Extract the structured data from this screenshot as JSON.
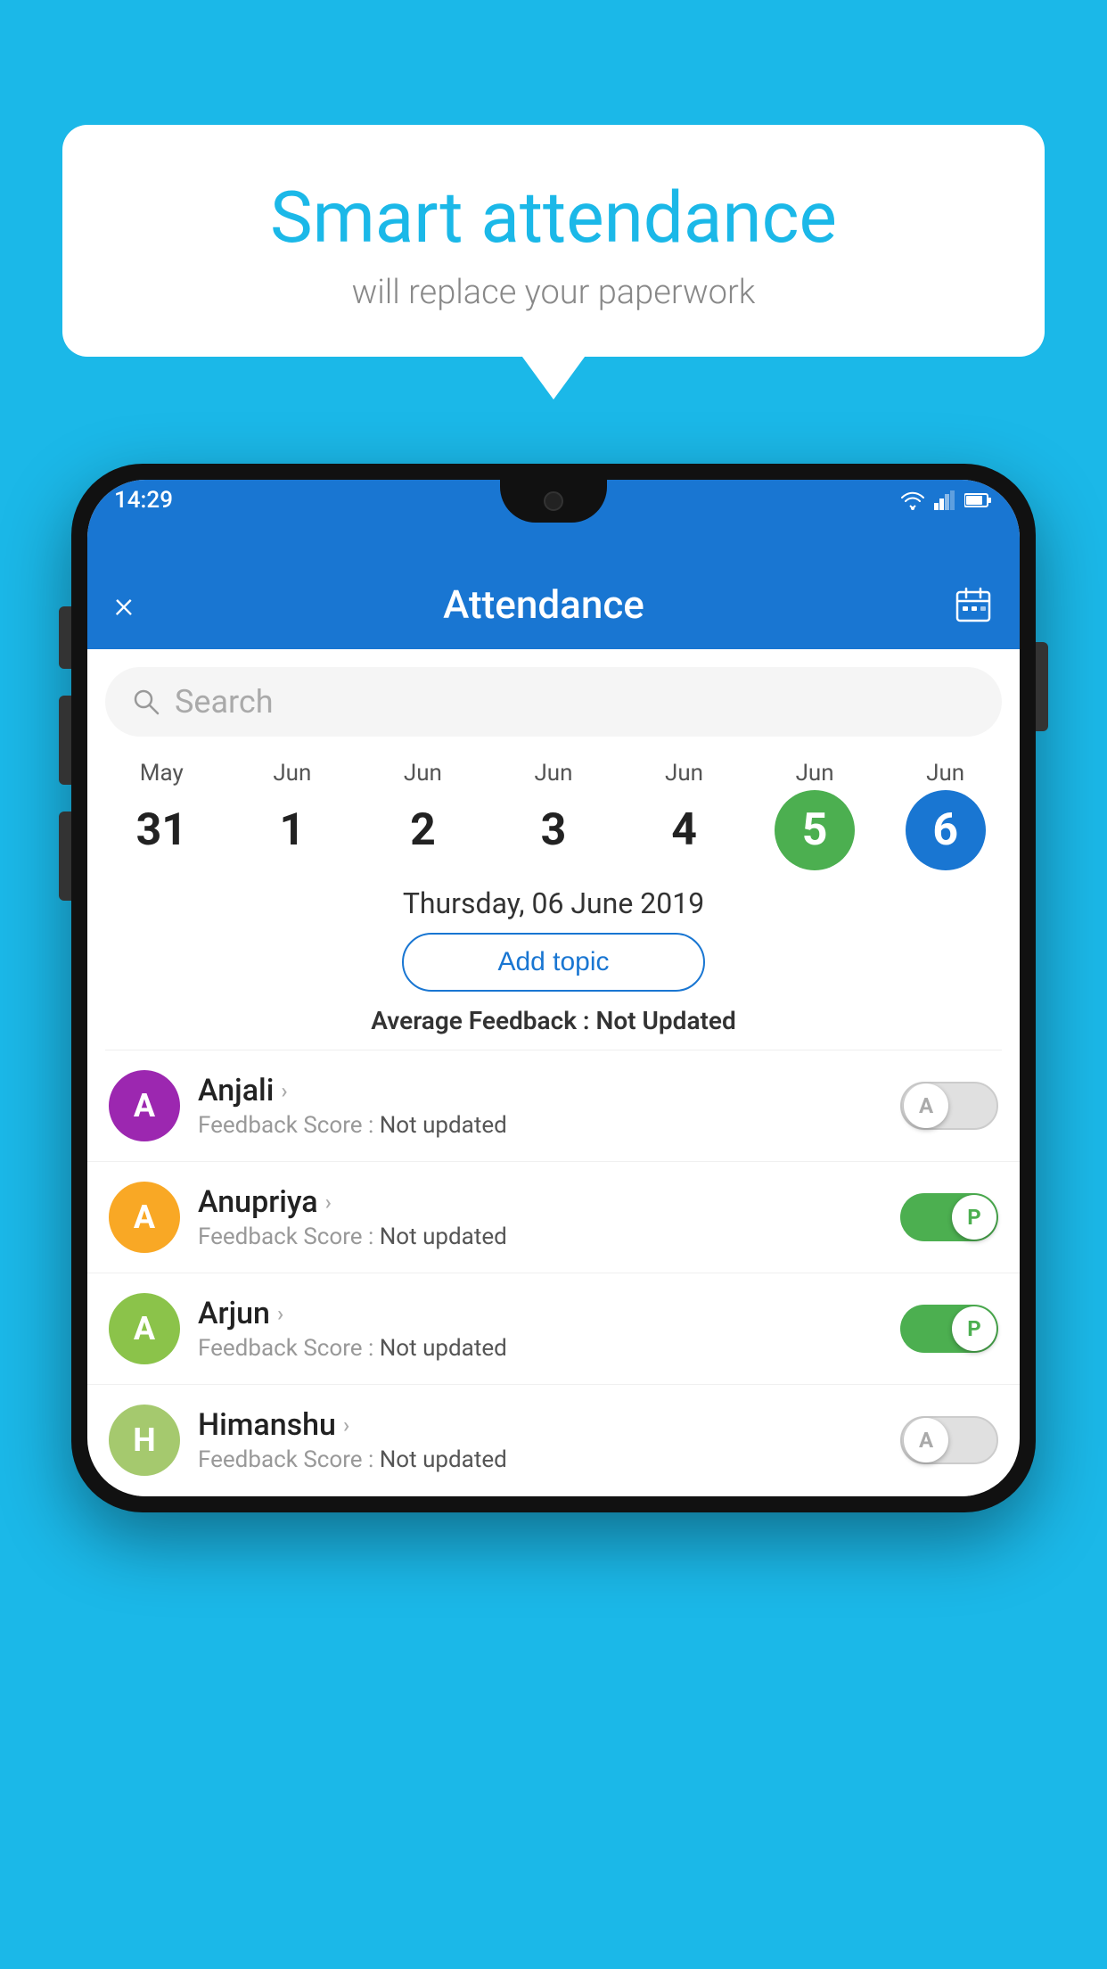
{
  "background_color": "#1bb8e8",
  "bubble": {
    "title": "Smart attendance",
    "subtitle": "will replace your paperwork"
  },
  "status_bar": {
    "time": "14:29",
    "icons": [
      "wifi",
      "signal",
      "battery"
    ]
  },
  "app_bar": {
    "title": "Attendance",
    "close_label": "×",
    "calendar_label": "📅"
  },
  "search": {
    "placeholder": "Search"
  },
  "calendar": {
    "days": [
      {
        "month": "May",
        "date": "31",
        "style": "normal"
      },
      {
        "month": "Jun",
        "date": "1",
        "style": "normal"
      },
      {
        "month": "Jun",
        "date": "2",
        "style": "normal"
      },
      {
        "month": "Jun",
        "date": "3",
        "style": "normal"
      },
      {
        "month": "Jun",
        "date": "4",
        "style": "normal"
      },
      {
        "month": "Jun",
        "date": "5",
        "style": "today"
      },
      {
        "month": "Jun",
        "date": "6",
        "style": "selected"
      }
    ]
  },
  "selected_date_label": "Thursday, 06 June 2019",
  "add_topic_label": "Add topic",
  "average_feedback": {
    "label": "Average Feedback :",
    "value": "Not Updated"
  },
  "students": [
    {
      "name": "Anjali",
      "avatar_letter": "A",
      "avatar_color": "#9c27b0",
      "feedback_label": "Feedback Score :",
      "feedback_value": "Not updated",
      "toggle": "off",
      "toggle_label": "A"
    },
    {
      "name": "Anupriya",
      "avatar_letter": "A",
      "avatar_color": "#f9a825",
      "feedback_label": "Feedback Score :",
      "feedback_value": "Not updated",
      "toggle": "on",
      "toggle_label": "P"
    },
    {
      "name": "Arjun",
      "avatar_letter": "A",
      "avatar_color": "#8bc34a",
      "feedback_label": "Feedback Score :",
      "feedback_value": "Not updated",
      "toggle": "on",
      "toggle_label": "P"
    },
    {
      "name": "Himanshu",
      "avatar_letter": "H",
      "avatar_color": "#a5c96e",
      "feedback_label": "Feedback Score :",
      "feedback_value": "Not updated",
      "toggle": "off",
      "toggle_label": "A"
    }
  ]
}
